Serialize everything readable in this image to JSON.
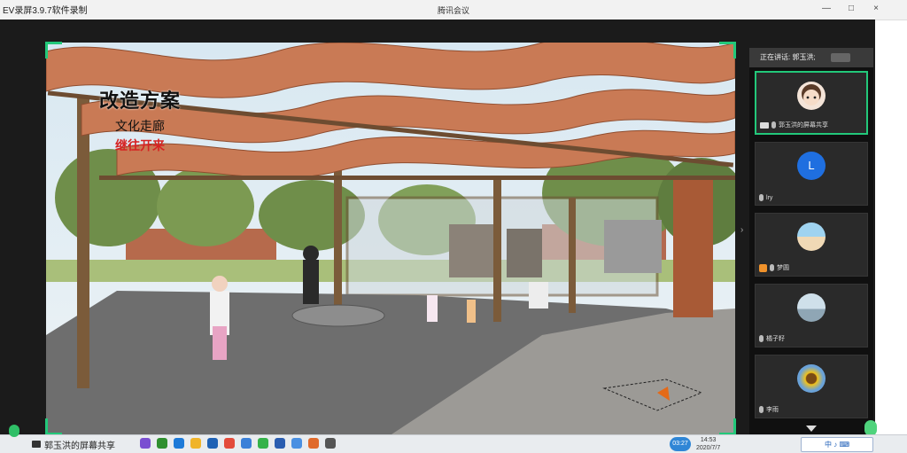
{
  "recorder": {
    "title": "EV录屏3.9.7软件录制"
  },
  "window": {
    "title": "腾讯会议",
    "controls": [
      "—",
      "□",
      "×"
    ]
  },
  "shared_screen": {
    "title": "改造方案",
    "subtitle": "文化走廊",
    "subtitle2": "继往开来"
  },
  "speaking_bar": {
    "label": "正在讲话: 郭玉洪;"
  },
  "participants": [
    {
      "name": "郭玉洪的屏幕共享",
      "avatar_type": "cartoon-girl",
      "active": true
    },
    {
      "name": "lry",
      "avatar_type": "letter",
      "avatar_letter": "L",
      "active": false
    },
    {
      "name": "梦圆",
      "avatar_type": "beach-photo",
      "active": false,
      "alert": true
    },
    {
      "name": "橘子籽",
      "avatar_type": "sea-photo",
      "active": false
    },
    {
      "name": "李雨",
      "avatar_type": "sunflower-photo",
      "active": false
    }
  ],
  "taskbar": {
    "share_banner": "郭玉洪的屏幕共享",
    "timer": "03:27",
    "time": "14:53",
    "date": "2020/7/7",
    "tray_text": "中 ♪ ⌨"
  },
  "colors": {
    "accent_green": "#22c87a",
    "avatar_blue": "#1f6fe0"
  }
}
